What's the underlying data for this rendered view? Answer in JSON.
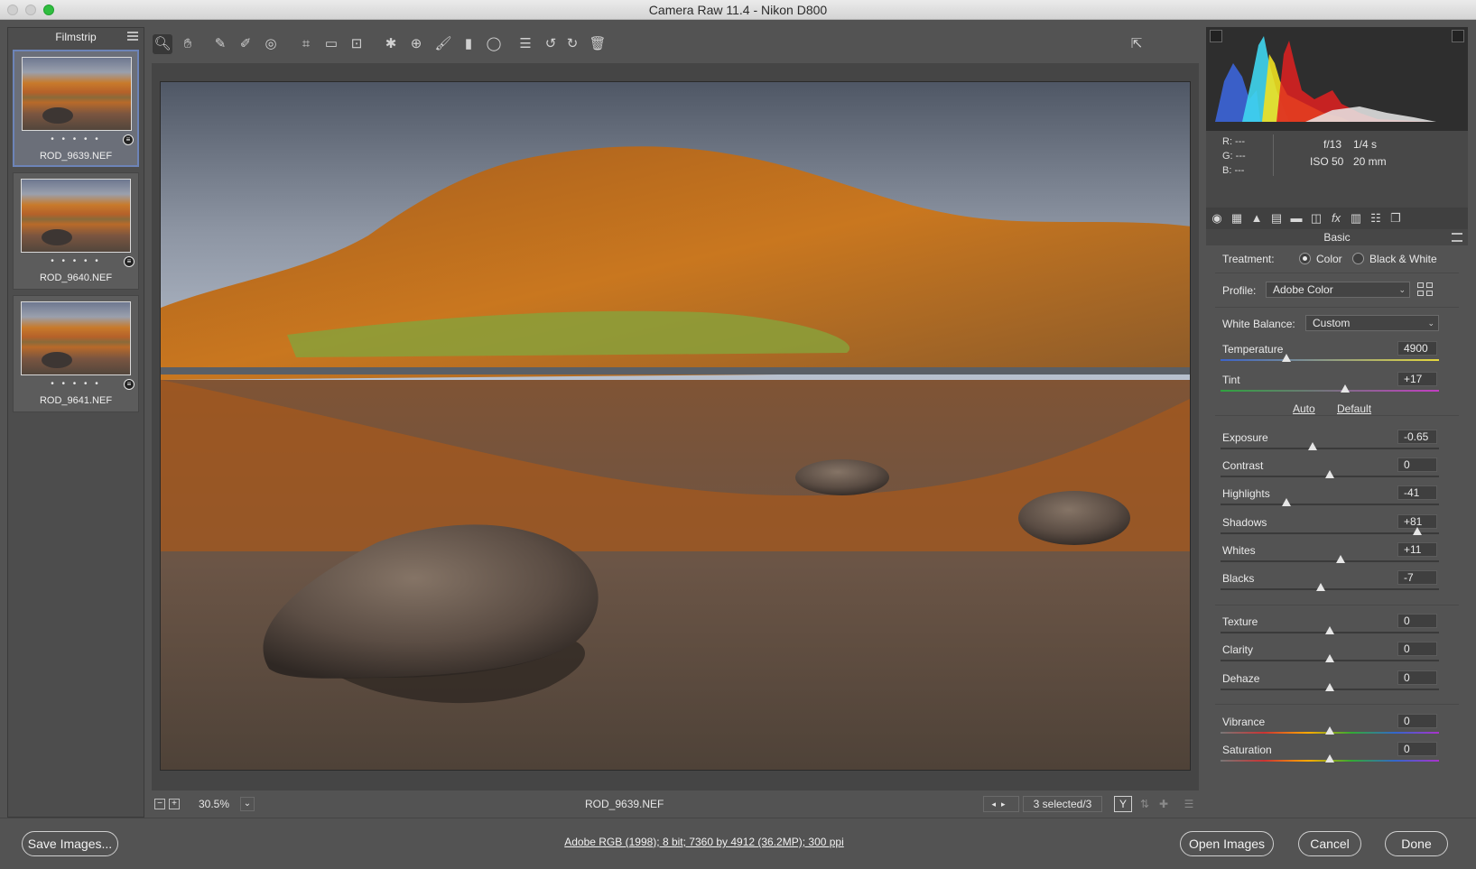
{
  "window": {
    "title": "Camera Raw 11.4  -  Nikon D800"
  },
  "filmstrip": {
    "title": "Filmstrip",
    "items": [
      {
        "name": "ROD_9639.NEF",
        "stars": "• • • • •",
        "selected": true
      },
      {
        "name": "ROD_9640.NEF",
        "stars": "• • • • •",
        "selected": false
      },
      {
        "name": "ROD_9641.NEF",
        "stars": "• • • • •",
        "selected": false
      }
    ]
  },
  "toolbar": {
    "tools": [
      "zoom-tool",
      "hand-tool",
      "white-balance-tool",
      "color-sampler-tool",
      "targeted-adjustment-tool",
      "crop-tool",
      "straighten-tool",
      "transform-tool",
      "spot-removal-tool",
      "red-eye-tool",
      "adjustment-brush-tool",
      "graduated-filter-tool",
      "radial-filter-tool",
      "preferences-tool",
      "rotate-ccw-tool",
      "rotate-cw-tool",
      "trash-tool"
    ]
  },
  "status": {
    "zoom": "30.5%",
    "filename": "ROD_9639.NEF",
    "selected": "3 selected/3",
    "y_toggle": "Y"
  },
  "info": {
    "r": "R:   ---",
    "g": "G:   ---",
    "b": "B:   ---",
    "aperture": "f/13",
    "shutter": "1/4 s",
    "iso": "ISO 50",
    "focal": "20 mm"
  },
  "panel": {
    "title": "Basic",
    "treatment_label": "Treatment:",
    "treatment_color": "Color",
    "treatment_bw": "Black & White",
    "profile_label": "Profile:",
    "profile_value": "Adobe Color",
    "wb_label": "White Balance:",
    "wb_value": "Custom",
    "auto": "Auto",
    "default": "Default",
    "sliders": [
      {
        "label": "Temperature",
        "value": "4900",
        "pos": 0.3
      },
      {
        "label": "Tint",
        "value": "+17",
        "pos": 0.57
      },
      {
        "label": "Exposure",
        "value": "-0.65",
        "pos": 0.42
      },
      {
        "label": "Contrast",
        "value": "0",
        "pos": 0.5
      },
      {
        "label": "Highlights",
        "value": "-41",
        "pos": 0.3
      },
      {
        "label": "Shadows",
        "value": "+81",
        "pos": 0.9
      },
      {
        "label": "Whites",
        "value": "+11",
        "pos": 0.55
      },
      {
        "label": "Blacks",
        "value": "-7",
        "pos": 0.46
      },
      {
        "label": "Texture",
        "value": "0",
        "pos": 0.5
      },
      {
        "label": "Clarity",
        "value": "0",
        "pos": 0.5
      },
      {
        "label": "Dehaze",
        "value": "0",
        "pos": 0.5
      },
      {
        "label": "Vibrance",
        "value": "0",
        "pos": 0.5
      },
      {
        "label": "Saturation",
        "value": "0",
        "pos": 0.5
      }
    ]
  },
  "bottom": {
    "save": "Save Images...",
    "workflow": "Adobe RGB (1998); 8 bit; 7360 by 4912 (36.2MP); 300 ppi",
    "open": "Open Images",
    "cancel": "Cancel",
    "done": "Done"
  }
}
